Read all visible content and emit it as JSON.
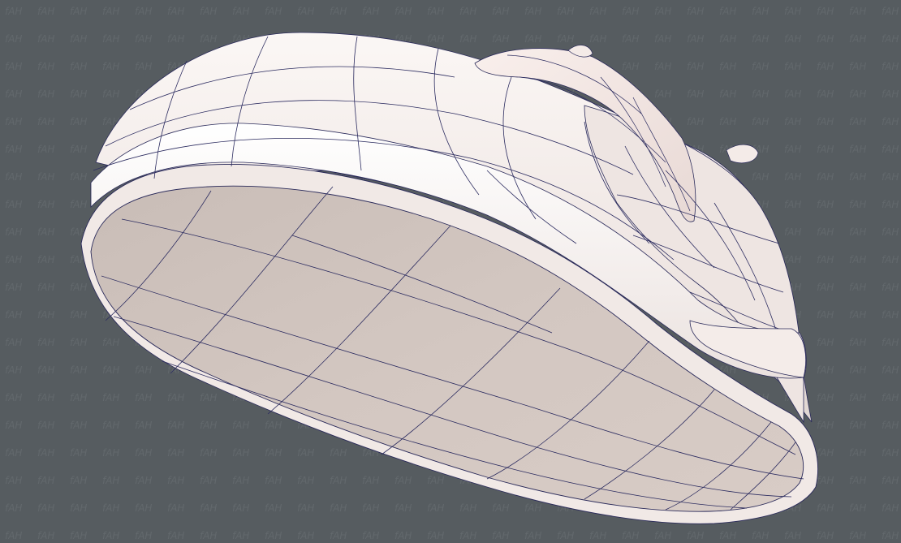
{
  "scene": {
    "background_color": "#565c60",
    "subject": "3D wireframe model render",
    "watermark_text": "fAH",
    "colors": {
      "shell": "#f2ecea",
      "shell_shadow": "#dcd3d0",
      "sole": "#cfc2bc",
      "sole_dark": "#b8aba6",
      "wire": "#2a2a5a",
      "watermark": "#6a7074"
    }
  }
}
